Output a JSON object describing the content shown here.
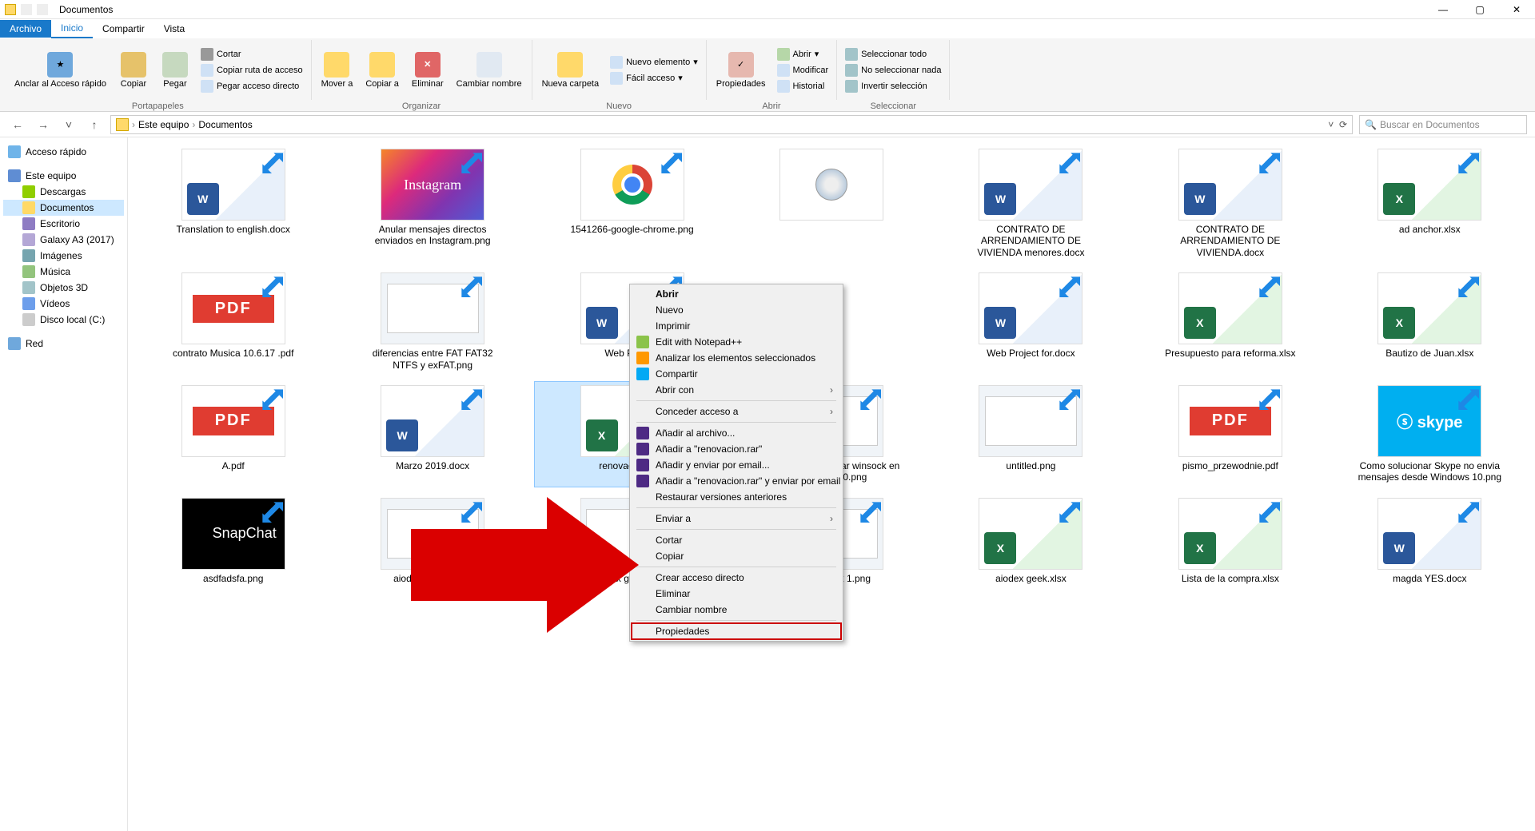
{
  "window": {
    "title": "Documentos"
  },
  "tabs": {
    "archivo": "Archivo",
    "inicio": "Inicio",
    "compartir": "Compartir",
    "vista": "Vista"
  },
  "ribbon": {
    "pin": "Anclar al Acceso rápido",
    "copy": "Copiar",
    "paste": "Pegar",
    "cut": "Cortar",
    "copy_path": "Copiar ruta de acceso",
    "paste_shortcut": "Pegar acceso directo",
    "clipboard": "Portapapeles",
    "move_to": "Mover a",
    "copy_to": "Copiar a",
    "delete": "Eliminar",
    "rename": "Cambiar nombre",
    "organize": "Organizar",
    "new_folder": "Nueva carpeta",
    "new_item": "Nuevo elemento",
    "easy_access": "Fácil acceso",
    "new": "Nuevo",
    "properties": "Propiedades",
    "open": "Abrir",
    "edit": "Modificar",
    "history": "Historial",
    "open_group": "Abrir",
    "select_all": "Seleccionar todo",
    "select_none": "No seleccionar nada",
    "invert_sel": "Invertir selección",
    "select": "Seleccionar"
  },
  "address": {
    "root": "Este equipo",
    "current": "Documentos",
    "search_placeholder": "Buscar en Documentos"
  },
  "sidebar": {
    "quick": "Acceso rápido",
    "pc": "Este equipo",
    "items": [
      "Descargas",
      "Documentos",
      "Escritorio",
      "Galaxy A3 (2017)",
      "Imágenes",
      "Música",
      "Objetos 3D",
      "Vídeos",
      "Disco local (C:)"
    ],
    "net": "Red"
  },
  "files": [
    {
      "name": "Translation to english.docx",
      "type": "docx"
    },
    {
      "name": "Anular mensajes directos enviados en Instagram.png",
      "type": "igram"
    },
    {
      "name": "1541266-google-chrome.png",
      "type": "chrome"
    },
    {
      "name": "",
      "type": "disc"
    },
    {
      "name": "CONTRATO DE ARRENDAMIENTO DE VIVIENDA menores.docx",
      "type": "docx"
    },
    {
      "name": "CONTRATO DE ARRENDAMIENTO DE VIVIENDA.docx",
      "type": "docx"
    },
    {
      "name": "ad anchor.xlsx",
      "type": "xlsx"
    },
    {
      "name": "contrato Musica 10.6.17 .pdf",
      "type": "pdf"
    },
    {
      "name": "diferencias entre FAT FAT32 NTFS y exFAT.png",
      "type": "screenshot"
    },
    {
      "name": "Web Project.",
      "type": "docx"
    },
    {
      "name": "",
      "type": "hidden"
    },
    {
      "name": "Web Project for.docx",
      "type": "docx"
    },
    {
      "name": "Presupuesto para reforma.xlsx",
      "type": "xlsx"
    },
    {
      "name": "Bautizo de Juan.xlsx",
      "type": "xlsx"
    },
    {
      "name": "A.pdf",
      "type": "pdf"
    },
    {
      "name": "Marzo 2019.docx",
      "type": "docx"
    },
    {
      "name": "renovacion.xlsx",
      "type": "xlsx",
      "selected": true
    },
    {
      "name": "Reiniciar o restaurar winsock en Windows 10.png",
      "type": "screenshot"
    },
    {
      "name": "untitled.png",
      "type": "screenshot"
    },
    {
      "name": "pismo_przewodnie.pdf",
      "type": "pdf"
    },
    {
      "name": "Como solucionar Skype no envia mensajes desde Windows 10.png",
      "type": "skype"
    },
    {
      "name": "asdfadsfa.png",
      "type": "snap"
    },
    {
      "name": "aiodex geek 3.png",
      "type": "screenshot"
    },
    {
      "name": "aiodex geek 2.png",
      "type": "screenshot"
    },
    {
      "name": "aiodex geek 1.png",
      "type": "screenshot"
    },
    {
      "name": "aiodex geek.xlsx",
      "type": "xlsx"
    },
    {
      "name": "Lista de la compra.xlsx",
      "type": "xlsx"
    },
    {
      "name": "magda YES.docx",
      "type": "docx"
    }
  ],
  "context_menu": {
    "open": "Abrir",
    "new": "Nuevo",
    "print": "Imprimir",
    "edit_notepad": "Edit with Notepad++",
    "analyze": "Analizar los elementos seleccionados",
    "share": "Compartir",
    "open_with": "Abrir con",
    "grant_access": "Conceder acceso a",
    "add_archive": "Añadir al archivo...",
    "add_rar": "Añadir a \"renovacion.rar\"",
    "add_email": "Añadir y enviar por email...",
    "add_rar_email": "Añadir a \"renovacion.rar\" y enviar por email",
    "restore": "Restaurar versiones anteriores",
    "send_to": "Enviar a",
    "cut": "Cortar",
    "copy": "Copiar",
    "shortcut": "Crear acceso directo",
    "delete": "Eliminar",
    "rename": "Cambiar nombre",
    "properties": "Propiedades"
  },
  "thumbnails": {
    "snapchat": "SnapChat",
    "skype": "skype",
    "pdf": "PDF",
    "instagram": "Instagram"
  }
}
